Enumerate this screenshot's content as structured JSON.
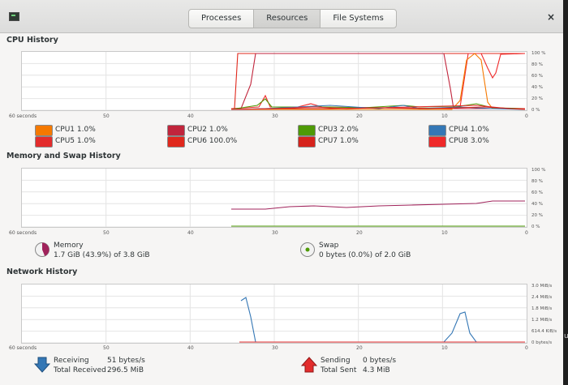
{
  "titlebar": {
    "tabs": [
      "Processes",
      "Resources",
      "File Systems"
    ],
    "active_tab": 1,
    "close_label": "×"
  },
  "x_ticks": [
    "60 seconds",
    "50",
    "40",
    "30",
    "20",
    "10",
    "0"
  ],
  "cpu": {
    "title": "CPU History",
    "y_ticks": [
      "100 %",
      "80 %",
      "60 %",
      "40 %",
      "20 %",
      "0 %"
    ],
    "cores": [
      {
        "name": "CPU1",
        "value": "1.0%",
        "color": "#f57900"
      },
      {
        "name": "CPU2",
        "value": "1.0%",
        "color": "#c1253c"
      },
      {
        "name": "CPU3",
        "value": "2.0%",
        "color": "#4e9a06"
      },
      {
        "name": "CPU4",
        "value": "1.0%",
        "color": "#3477b5"
      },
      {
        "name": "CPU5",
        "value": "1.0%",
        "color": "#e32c2c"
      },
      {
        "name": "CPU6",
        "value": "100.0%",
        "color": "#e0281c"
      },
      {
        "name": "CPU7",
        "value": "1.0%",
        "color": "#d6231c"
      },
      {
        "name": "CPU8",
        "value": "3.0%",
        "color": "#ef2929"
      }
    ]
  },
  "memory": {
    "title": "Memory and Swap History",
    "y_ticks": [
      "100 %",
      "80 %",
      "60 %",
      "40 %",
      "20 %",
      "0 %"
    ],
    "memory_label": "Memory",
    "memory_value": "1.7 GiB (43.9%) of 3.8 GiB",
    "memory_fraction": 0.439,
    "memory_color": "#a0235b",
    "swap_label": "Swap",
    "swap_value": "0 bytes (0.0%) of 2.0 GiB",
    "swap_fraction": 0.0,
    "swap_color": "#4e9a06"
  },
  "network": {
    "title": "Network History",
    "y_ticks": [
      "3.0 MiB/s",
      "2.4 MiB/s",
      "1.8 MiB/s",
      "1.2 MiB/s",
      "614.4 KiB/s",
      "0 bytes/s"
    ],
    "receiving_label": "Receiving",
    "receiving_value": "51 bytes/s",
    "total_received_label": "Total Received",
    "total_received_value": "296.5 MiB",
    "receiving_color": "#3477b5",
    "sending_label": "Sending",
    "sending_value": "0 bytes/s",
    "total_sent_label": "Total Sent",
    "total_sent_value": "4.3 MiB",
    "sending_color": "#e32c2c"
  },
  "side_label": "u"
}
